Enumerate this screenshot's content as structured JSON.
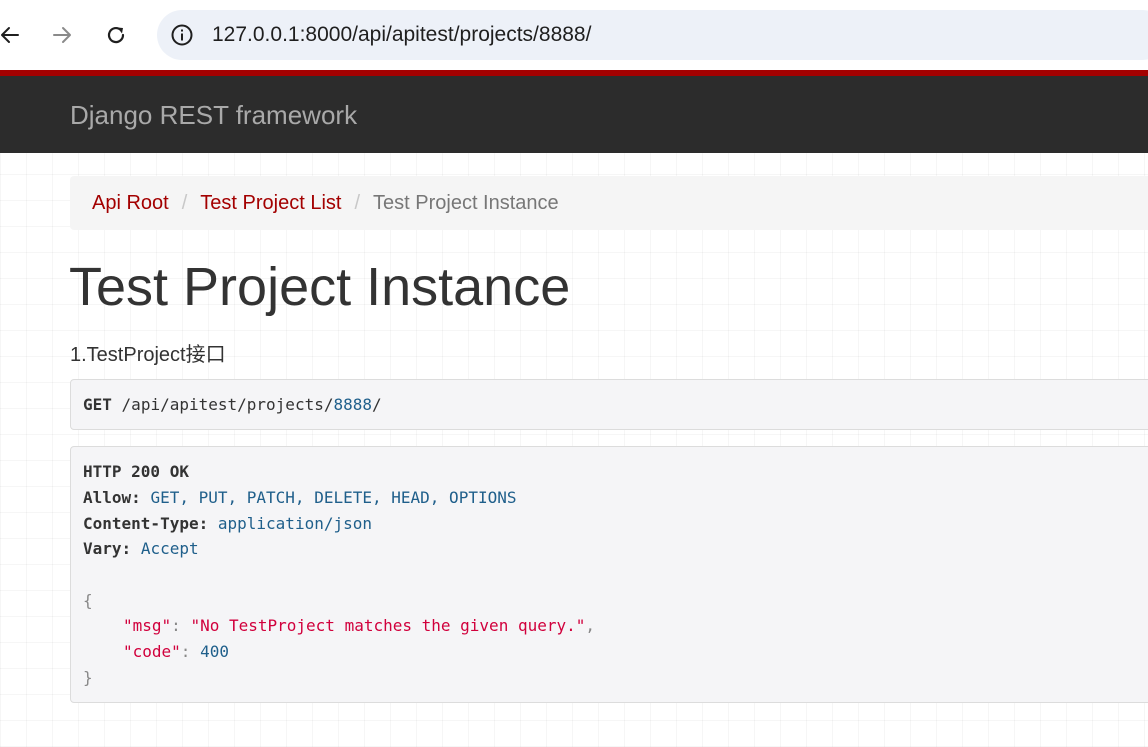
{
  "browser": {
    "url": "127.0.0.1:8000/api/apitest/projects/8888/"
  },
  "header": {
    "brand": "Django REST framework"
  },
  "breadcrumb": {
    "items": [
      "Api Root",
      "Test Project List"
    ],
    "separator": "/",
    "active": "Test Project Instance"
  },
  "content": {
    "title": "Test Project Instance",
    "description": "1.TestProject接口"
  },
  "request": {
    "method": "GET",
    "path_prefix": "/api/apitest/projects/",
    "path_id": "8888",
    "path_suffix": "/"
  },
  "response": {
    "status": "HTTP 200 OK",
    "allow_key": "Allow:",
    "allow_value": "GET, PUT, PATCH, DELETE, HEAD, OPTIONS",
    "content_type_key": "Content-Type:",
    "content_type_value": "application/json",
    "vary_key": "Vary:",
    "vary_value": "Accept",
    "body": {
      "open_brace": "{",
      "msg_key": "\"msg\"",
      "msg_value": "\"No TestProject matches the given query.\"",
      "code_key": "\"code\"",
      "code_value": "400",
      "close_brace": "}"
    }
  },
  "colors": {
    "accent_red": "#a30000",
    "navbar": "#2c2c2c",
    "string": "#d1003c",
    "literal": "#1f5f8b"
  }
}
